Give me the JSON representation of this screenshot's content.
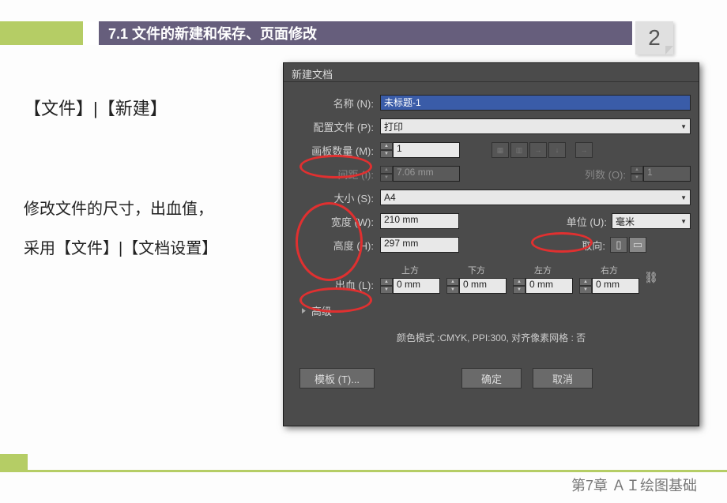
{
  "header": {
    "title": "7.1 文件的新建和保存、页面修改",
    "page_number": "2"
  },
  "side": {
    "menu_path": "【文件】|【新建】",
    "description_line1": "修改文件的尺寸，出血值，",
    "description_line2": "采用【文件】|【文档设置】"
  },
  "dialog": {
    "title": "新建文档",
    "name_label": "名称 (N):",
    "name_value": "未标题-1",
    "profile_label": "配置文件 (P):",
    "profile_value": "打印",
    "artboards_label": "画板数量 (M):",
    "artboards_value": "1",
    "spacing_label": "间距 (I):",
    "spacing_value": "7.06 mm",
    "columns_label": "列数 (O):",
    "columns_value": "1",
    "size_label": "大小 (S):",
    "size_value": "A4",
    "width_label": "宽度 (W):",
    "width_value": "210 mm",
    "units_label": "单位 (U):",
    "units_value": "毫米",
    "height_label": "高度 (H):",
    "height_value": "297 mm",
    "orient_label": "取向:",
    "bleed_label": "出血 (L):",
    "bleed_top": "上方",
    "bleed_bottom": "下方",
    "bleed_left": "左方",
    "bleed_right": "右方",
    "bleed_value": "0 mm",
    "advanced": "高级",
    "mode_info": "颜色模式 :CMYK, PPI:300, 对齐像素网格 : 否",
    "template_btn": "模板 (T)...",
    "ok_btn": "确定",
    "cancel_btn": "取消"
  },
  "footer": {
    "chapter": "第7章 ＡＩ绘图基础"
  }
}
